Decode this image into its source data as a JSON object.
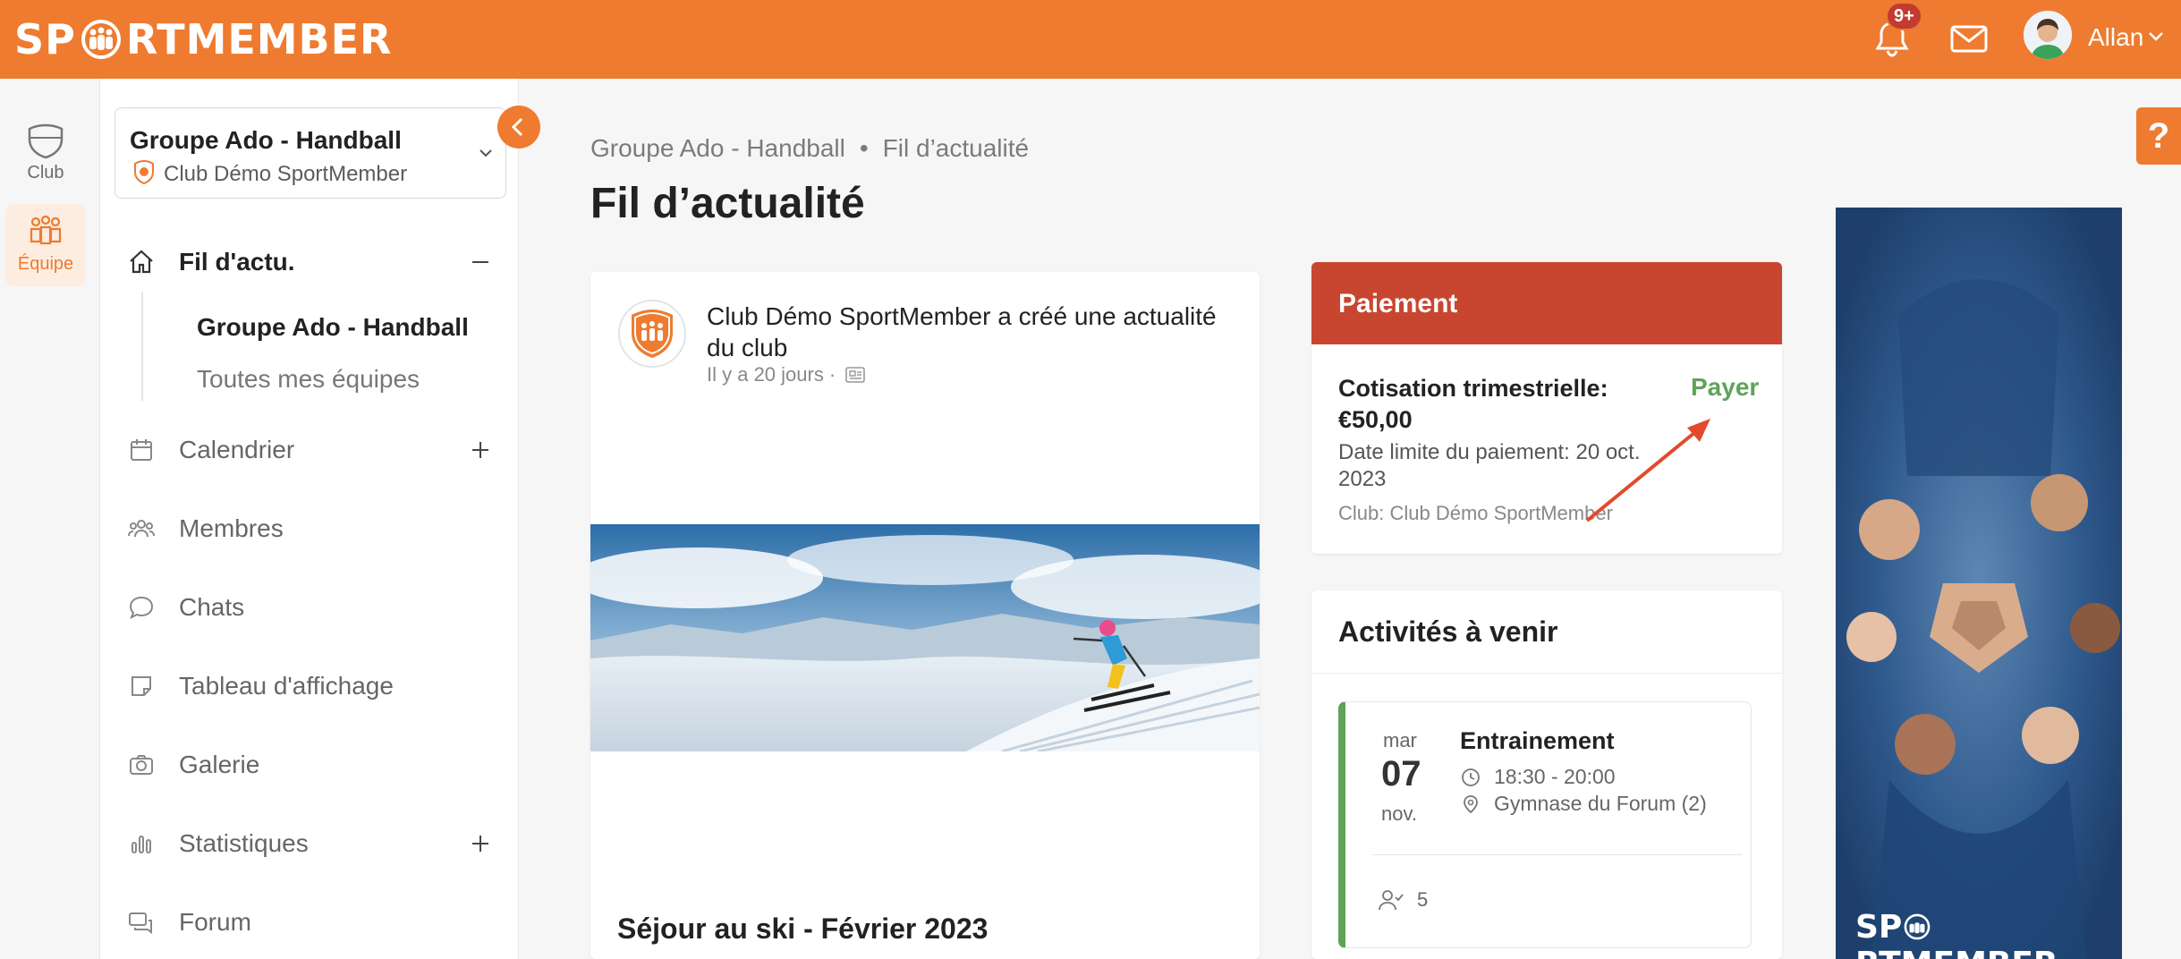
{
  "app": {
    "logo_left": "SP",
    "logo_right": "RTMEMBER"
  },
  "header": {
    "notification_badge": "9+",
    "user_name": "Allan"
  },
  "rail": {
    "club_label": "Club",
    "team_label": "Équipe"
  },
  "sidebar": {
    "group_title": "Groupe Ado - Handball",
    "group_club": "Club Démo SportMember",
    "items": [
      {
        "label": "Fil d'actu.",
        "sign": "minus"
      },
      {
        "label": "Calendrier",
        "sign": "plus"
      },
      {
        "label": "Membres"
      },
      {
        "label": "Chats"
      },
      {
        "label": "Tableau d'affichage"
      },
      {
        "label": "Galerie"
      },
      {
        "label": "Statistiques",
        "sign": "plus"
      },
      {
        "label": "Forum"
      }
    ],
    "sub_items": [
      "Groupe Ado - Handball",
      "Toutes mes équipes"
    ]
  },
  "breadcrumb": {
    "parent": "Groupe Ado - Handball",
    "separator": "•",
    "current": "Fil d’actualité"
  },
  "page_title": "Fil d’actualité",
  "post": {
    "author": "Club Démo SportMember a créé une actualité du club",
    "time": "Il y a 20 jours",
    "separator": "·",
    "title": "Séjour au ski - Février 2023"
  },
  "payment": {
    "header": "Paiement",
    "name": "Cotisation trimestrielle: €50,00",
    "pay_button": "Payer",
    "deadline": "Date limite du paiement: 20 oct. 2023",
    "club": "Club: Club Démo SportMember"
  },
  "activities": {
    "header": "Activités à venir",
    "event": {
      "day_of_week": "mar",
      "day": "07",
      "month": "nov.",
      "title": "Entrainement",
      "time": "18:30 - 20:00",
      "location": "Gymnase du Forum (2)",
      "attendees": "5"
    }
  },
  "ad": {
    "logo_left": "SP",
    "logo_right": "RTMEMBER"
  },
  "help": {
    "label": "?"
  },
  "colors": {
    "brand": "#ee7b30",
    "payment_header": "#c8462f",
    "pay_green": "#5ea35a",
    "badge": "#c33a30"
  }
}
